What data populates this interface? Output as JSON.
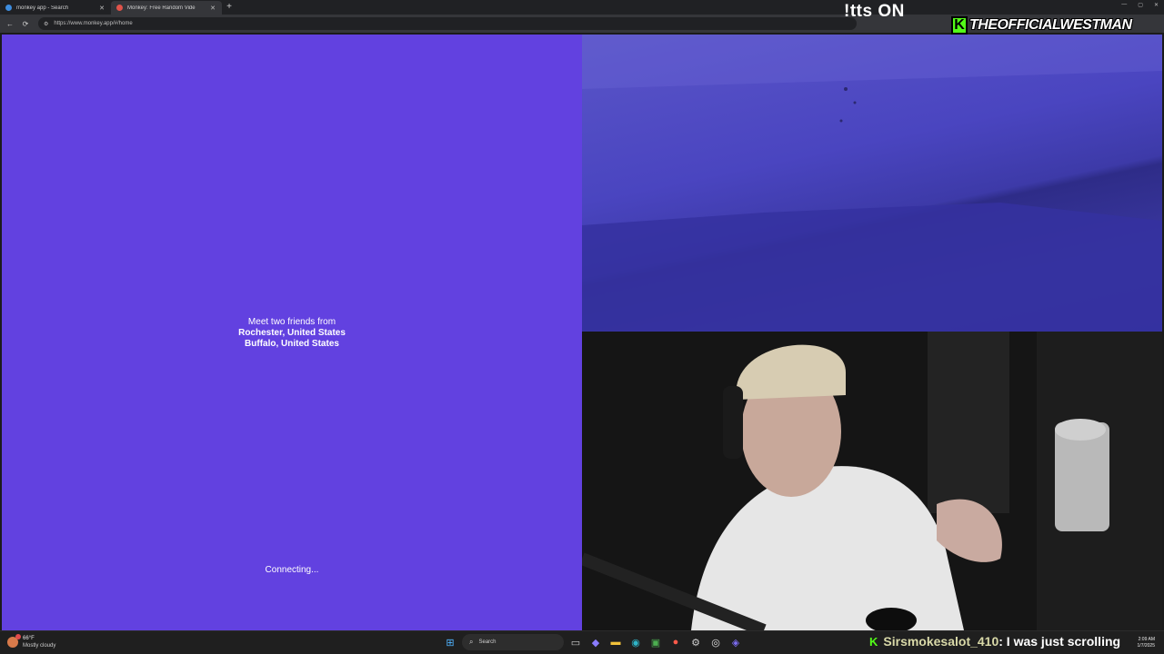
{
  "browser": {
    "tabs": [
      {
        "title": "monkey app - Search",
        "active": false,
        "favicon_color": "#3d8de0"
      },
      {
        "title": "Monkey: Free Random Vide",
        "active": true,
        "favicon_color": "#e0534a"
      }
    ],
    "new_tab": "+",
    "window_controls": [
      "—",
      "▢",
      "✕"
    ],
    "nav": {
      "back": "←",
      "reload": "⟳"
    },
    "url": "https://www.monkey.app/#/home"
  },
  "overlay": {
    "tts": "!tts ON",
    "brand_badge": "K",
    "brand_name": "THEOFFICIALWESTMAN"
  },
  "main": {
    "meet_line": "Meet two friends from",
    "location_1": "Rochester, United States",
    "location_2": "Buffalo, United States",
    "status": "Connecting..."
  },
  "taskbar": {
    "weather_temp": "66°F",
    "weather_condition": "Mostly cloudy",
    "search_label": "Search",
    "chat_badge": "K",
    "chat_user": "Sirsmokesalot_410",
    "chat_message": " : I was just scrolling",
    "clock_time": "2:09 AM",
    "clock_date": "1/7/2025"
  },
  "colors": {
    "left_pane": "#6241e0",
    "kick_green": "#53fc18"
  }
}
